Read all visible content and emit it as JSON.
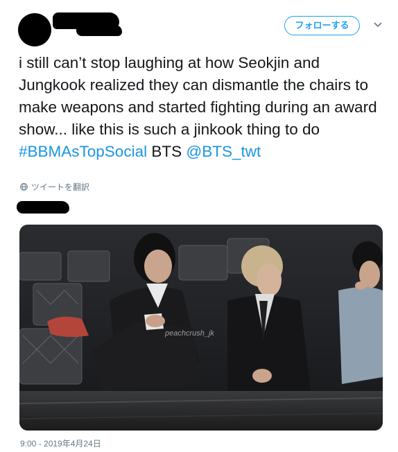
{
  "header": {
    "follow_label": "フォローする"
  },
  "tweet": {
    "text_parts": {
      "main": "i still can’t stop laughing at how Seokjin and Jungkook realized they can dismantle the chairs to make weapons and started fighting during an award show... like this is such a jinkook thing to do ",
      "hashtag": "#BBMAsTopSocial",
      "middle": " BTS ",
      "mention": "@BTS_twt"
    },
    "translate_label": "ツイートを翻訳",
    "media_watermark": "peachcrush_jk",
    "timestamp": "9:00 - 2019年4月24日"
  },
  "colors": {
    "accent": "#1da1f2",
    "link": "#1b95e0",
    "muted": "#657786"
  }
}
